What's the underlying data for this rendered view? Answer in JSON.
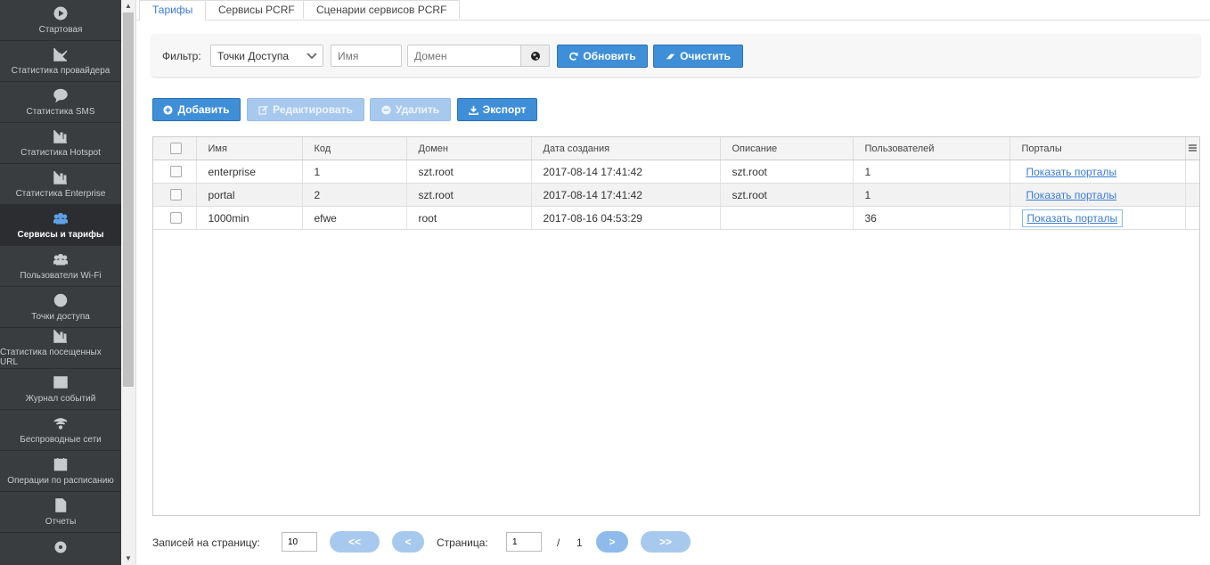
{
  "sidebar": {
    "items": [
      {
        "label": "Стартовая",
        "icon": "play-circle-icon"
      },
      {
        "label": "Статистика провайдера",
        "icon": "line-chart-icon"
      },
      {
        "label": "Статистика SMS",
        "icon": "chat-bubble-icon"
      },
      {
        "label": "Статистика Hotspot",
        "icon": "bar-chart-icon"
      },
      {
        "label": "Статистика Enterprise",
        "icon": "bar-chart-icon"
      },
      {
        "label": "Сервисы и тарифы",
        "icon": "users-icon",
        "active": true
      },
      {
        "label": "Пользователи Wi-Fi",
        "icon": "users-icon"
      },
      {
        "label": "Точки доступа",
        "icon": "target-icon"
      },
      {
        "label": "Статистика посещенных URL",
        "icon": "bar-chart-icon"
      },
      {
        "label": "Журнал событий",
        "icon": "table-icon"
      },
      {
        "label": "Беспроводные сети",
        "icon": "wifi-icon"
      },
      {
        "label": "Операции по расписанию",
        "icon": "calendar-x-icon"
      },
      {
        "label": "Отчеты",
        "icon": "document-icon"
      }
    ]
  },
  "tabs": [
    {
      "label": "Тарифы",
      "active": true
    },
    {
      "label": "Сервисы PCRF"
    },
    {
      "label": "Сценарии сервисов PCRF"
    }
  ],
  "filter": {
    "label": "Фильтр:",
    "select_value": "Точки Доступа",
    "name_placeholder": "Имя",
    "domain_placeholder": "Домен",
    "refresh_label": "Обновить",
    "clear_label": "Очистить"
  },
  "toolbar": {
    "add_label": "Добавить",
    "edit_label": "Редактировать",
    "delete_label": "Удалить",
    "export_label": "Экспорт"
  },
  "grid": {
    "columns": [
      "Имя",
      "Код",
      "Домен",
      "Дата создания",
      "Описание",
      "Пользователей",
      "Порталы"
    ],
    "rows": [
      [
        "enterprise",
        "1",
        "szt.root",
        "2017-08-14 17:41:42",
        "szt.root",
        "1",
        "Показать порталы"
      ],
      [
        "portal",
        "2",
        "szt.root",
        "2017-08-14 17:41:42",
        "szt.root",
        "1",
        "Показать порталы"
      ],
      [
        "1000min",
        "efwe",
        "root",
        "2017-08-16 04:53:29",
        "",
        "36",
        "Показать порталы"
      ]
    ]
  },
  "pager": {
    "per_page_label": "Записей на страницу:",
    "per_page_value": "10",
    "first": "<<",
    "prev": "<",
    "page_label": "Страница:",
    "page_value": "1",
    "sep": "/",
    "total_pages": "1",
    "next": ">",
    "last": ">>"
  }
}
